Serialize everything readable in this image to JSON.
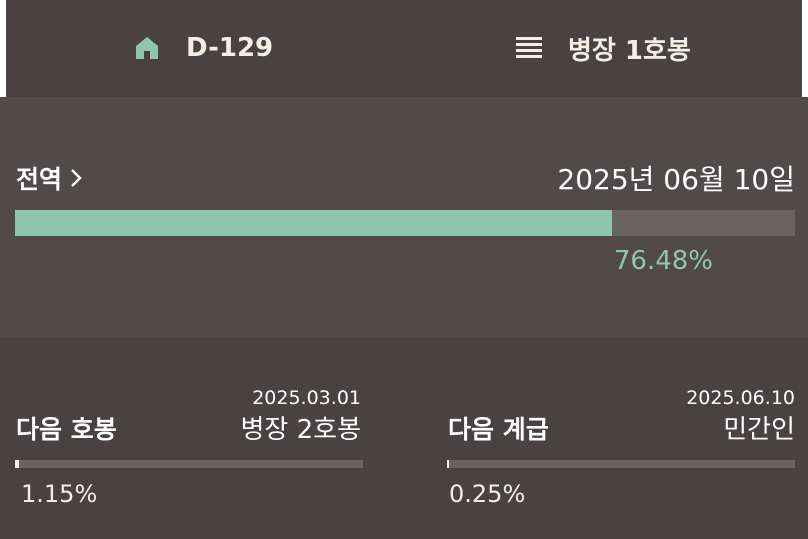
{
  "header": {
    "dday": "D-129",
    "rank": "병장 1호봉"
  },
  "service": {
    "label": "전역",
    "date": "2025년 06월 10일",
    "progress": 76.48,
    "percent_text": "76.48%"
  },
  "next_step": {
    "title": "다음 호봉",
    "date": "2025.03.01",
    "value": "병장 2호봉",
    "progress": 1.15,
    "percent_text": "1.15%"
  },
  "next_rank": {
    "title": "다음 계급",
    "date": "2025.06.10",
    "value": "민간인",
    "progress": 0.25,
    "percent_text": "0.25%"
  },
  "colors": {
    "accent": "#8fc4ad",
    "header_bg": "#4a4242",
    "card_bg": "#524a4a",
    "track": "#6b6262",
    "cream": "#f4efe6"
  }
}
